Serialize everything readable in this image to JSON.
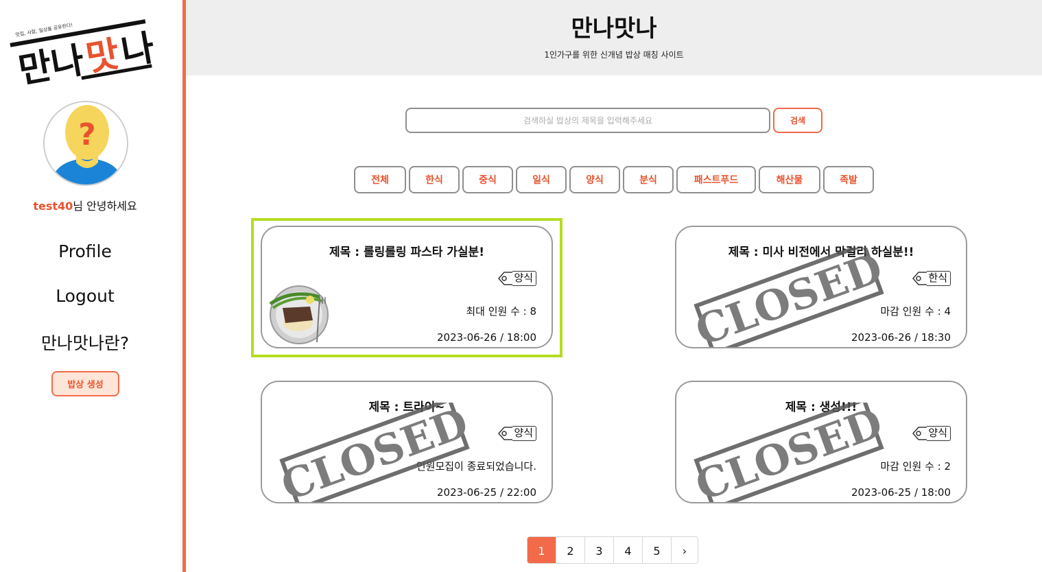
{
  "sidebar": {
    "logo": {
      "main_text": "만나맛나",
      "tagline": "맛집, 사람, 일상을 공유한다!"
    },
    "greeting": {
      "username": "test40",
      "suffix": "님 안녕하세요"
    },
    "nav": {
      "profile": "Profile",
      "logout": "Logout",
      "about": "만나맛나란?"
    },
    "create_button": "밥상 생성"
  },
  "header": {
    "title": "만나맛나",
    "subtitle": "1인가구를 위한 신개념 밥상 매칭 사이트"
  },
  "search": {
    "placeholder": "검색하실 밥상의 제목을 입력해주세요",
    "value": "",
    "button": "검색"
  },
  "categories": [
    "전체",
    "한식",
    "중식",
    "일식",
    "양식",
    "분식",
    "패스트푸드",
    "해산물",
    "족발"
  ],
  "cards": [
    {
      "title": "제목 : 롤링롤링 파스타 가실분!",
      "tag": "양식",
      "info": "최대 인원 수 : 8",
      "datetime": "2023-06-26 / 18:00",
      "closed": false
    },
    {
      "title": "제목 : 미사 비전에서 막걸리 하실분!!",
      "tag": "한식",
      "info": "마감 인원 수 : 4",
      "datetime": "2023-06-26 / 18:30",
      "closed": true
    },
    {
      "title": "제목 : 트라이~",
      "tag": "양식",
      "info": "인원모집이 종료되었습니다.",
      "datetime": "2023-06-25 / 22:00",
      "closed": true
    },
    {
      "title": "제목 : 생성!!!",
      "tag": "양식",
      "info": "마감 인원 수 : 2",
      "datetime": "2023-06-25 / 18:00",
      "closed": true
    }
  ],
  "stamp_text": "CLOSED",
  "pagination": {
    "pages": [
      "1",
      "2",
      "3",
      "4",
      "5"
    ],
    "next": "›",
    "current": "1"
  },
  "colors": {
    "accent": "#f26a4a",
    "highlight": "#b5dc23",
    "header_bg": "#eeeeee"
  }
}
